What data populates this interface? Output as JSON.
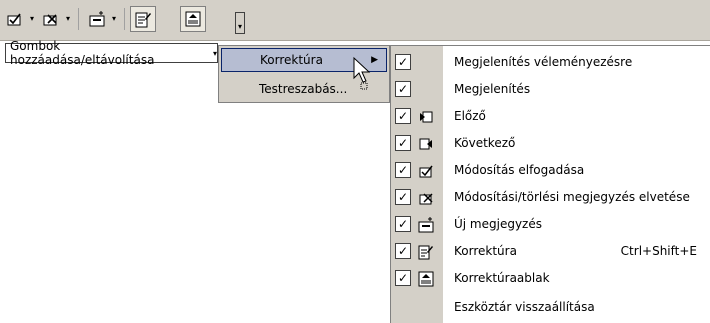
{
  "toolbar": {
    "buttons": [
      {
        "icon": "accept-change-icon"
      },
      {
        "icon": "reject-change-icon"
      },
      {
        "icon": "new-comment-icon"
      },
      {
        "icon": "track-changes-icon"
      },
      {
        "icon": "reviewing-pane-icon"
      }
    ],
    "overflow_icon": "toolbar-options-chevron-icon"
  },
  "menu1": {
    "label": "Gombok hozzáadása/eltávolítása",
    "arrow": "▾"
  },
  "menu2": {
    "items": [
      {
        "label": "Korrektúra",
        "has_submenu": true,
        "highlighted": true
      },
      {
        "label": "Testreszabás...",
        "has_submenu": false,
        "highlighted": false
      }
    ],
    "submenu_arrow": "▶"
  },
  "menu3": {
    "items": [
      {
        "label": "Megjelenítés véleményezésre",
        "checked": true,
        "icon": "",
        "shortcut": ""
      },
      {
        "label": "Megjelenítés",
        "checked": true,
        "icon": "",
        "shortcut": ""
      },
      {
        "label": "Előző",
        "checked": true,
        "icon": "previous-icon",
        "shortcut": ""
      },
      {
        "label": "Következő",
        "checked": true,
        "icon": "next-icon",
        "shortcut": ""
      },
      {
        "label": "Módosítás elfogadása",
        "checked": true,
        "icon": "accept-change-icon",
        "shortcut": ""
      },
      {
        "label": "Módosítási/törlési megjegyzés elvetése",
        "checked": true,
        "icon": "reject-change-icon",
        "shortcut": ""
      },
      {
        "label": "Új megjegyzés",
        "checked": true,
        "icon": "new-comment-icon",
        "shortcut": ""
      },
      {
        "label": "Korrektúra",
        "checked": true,
        "icon": "track-changes-icon",
        "shortcut": "Ctrl+Shift+E"
      },
      {
        "label": "Korrektúraablak",
        "checked": true,
        "icon": "reviewing-pane-icon",
        "shortcut": ""
      },
      {
        "label": "Eszköztár visszaállítása",
        "checked": false,
        "icon": "",
        "shortcut": ""
      }
    ]
  },
  "check_mark": "✓"
}
